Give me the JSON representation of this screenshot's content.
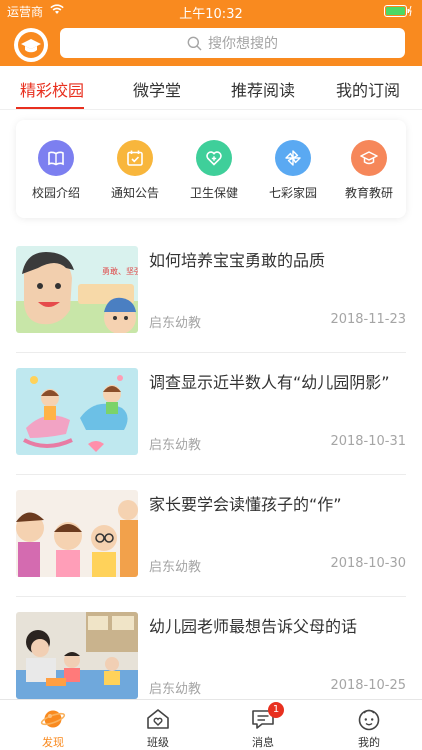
{
  "status_bar": {
    "carrier": "运营商",
    "time": "上午10:32"
  },
  "search": {
    "placeholder": "搜你想搜的"
  },
  "tabs": [
    {
      "label": "精彩校园",
      "active": true
    },
    {
      "label": "微学堂",
      "active": false
    },
    {
      "label": "推荐阅读",
      "active": false
    },
    {
      "label": "我的订阅",
      "active": false
    }
  ],
  "categories": [
    {
      "label": "校园介绍",
      "icon": "book-icon",
      "color": "#7c7ff0"
    },
    {
      "label": "通知公告",
      "icon": "calendar-icon",
      "color": "#f8b63c"
    },
    {
      "label": "卫生保健",
      "icon": "health-heart-icon",
      "color": "#3fcf9a"
    },
    {
      "label": "七彩家园",
      "icon": "pinwheel-icon",
      "color": "#5aa9f2"
    },
    {
      "label": "教育教研",
      "icon": "graduation-cap-icon",
      "color": "#f6875a"
    }
  ],
  "articles": [
    {
      "title": "如何培养宝宝勇敢的品质",
      "source": "启东幼教",
      "date": "2018-11-23"
    },
    {
      "title": "调查显示近半数人有“幼儿园阴影”",
      "source": "启东幼教",
      "date": "2018-10-31"
    },
    {
      "title": "家长要学会读懂孩子的“作”",
      "source": "启东幼教",
      "date": "2018-10-30"
    },
    {
      "title": "幼儿园老师最想告诉父母的话",
      "source": "启东幼教",
      "date": "2018-10-25"
    }
  ],
  "thumb1_text": "勇敢、坚强",
  "bottom_nav": [
    {
      "label": "发现",
      "icon": "planet-icon",
      "active": true
    },
    {
      "label": "班级",
      "icon": "house-heart-icon",
      "active": false
    },
    {
      "label": "消息",
      "icon": "message-icon",
      "active": false,
      "badge": "1"
    },
    {
      "label": "我的",
      "icon": "child-face-icon",
      "active": false
    }
  ],
  "colors": {
    "brand": "#f98a1f",
    "active_tab": "#e8301f"
  }
}
